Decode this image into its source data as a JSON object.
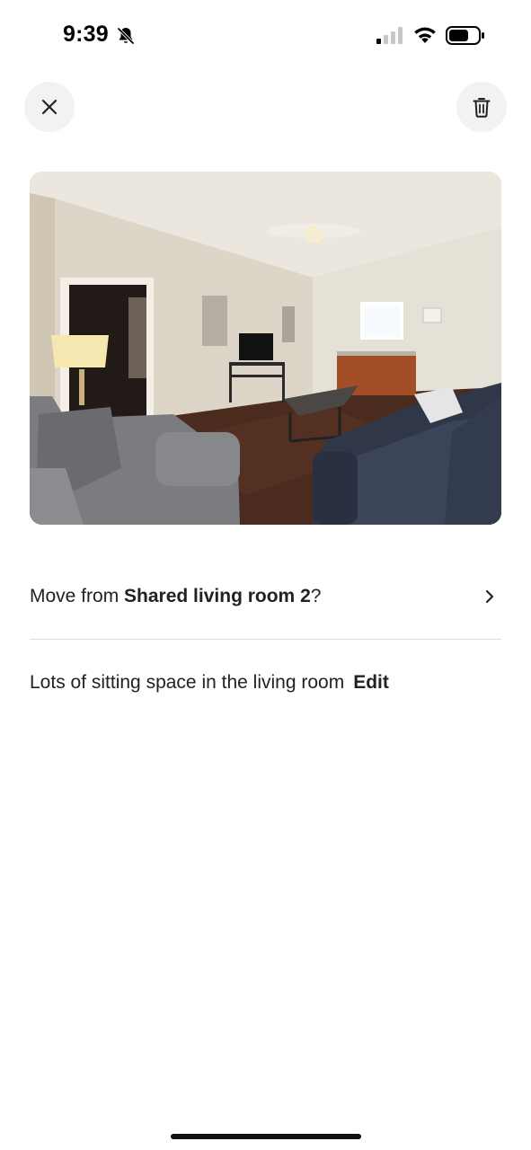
{
  "status_bar": {
    "time": "9:39",
    "icons": [
      "bell-slash-icon",
      "cellular-signal-icon",
      "wifi-icon",
      "battery-icon"
    ]
  },
  "toolbar": {
    "close_icon": "close-icon",
    "delete_icon": "trash-icon"
  },
  "photo": {
    "subject": "living-room-photo"
  },
  "move_row": {
    "prefix": "Move from ",
    "room_name": "Shared living room 2",
    "suffix": "?",
    "chevron_icon": "chevron-right-icon"
  },
  "caption": {
    "text": "Lots of sitting space in the living room",
    "edit_label": "Edit"
  },
  "colors": {
    "background": "#ffffff",
    "text": "#222222",
    "button_bg": "#f2f2f2",
    "divider": "#dddddd"
  }
}
